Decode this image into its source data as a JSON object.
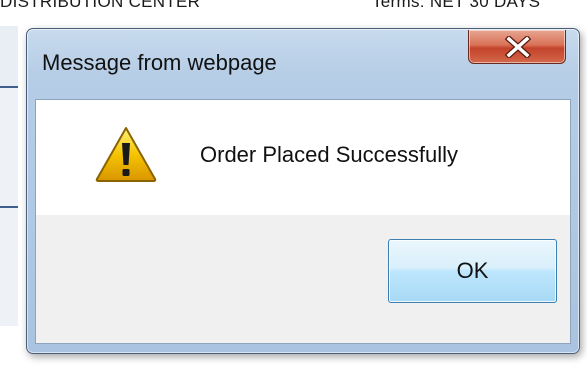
{
  "background": {
    "left_text": "DISTRIBUTION CENTER",
    "right_text": "Terms: NET 30 DAYS"
  },
  "dialog": {
    "title": "Message from webpage",
    "message": "Order Placed Successfully",
    "ok_label": "OK",
    "icons": {
      "close": "close-icon",
      "warning": "warning-icon"
    },
    "colors": {
      "frame": "#b6cde6",
      "close_button": "#c2432a",
      "ok_button": "#bee6fd",
      "warning_fill": "#f5c400"
    }
  }
}
